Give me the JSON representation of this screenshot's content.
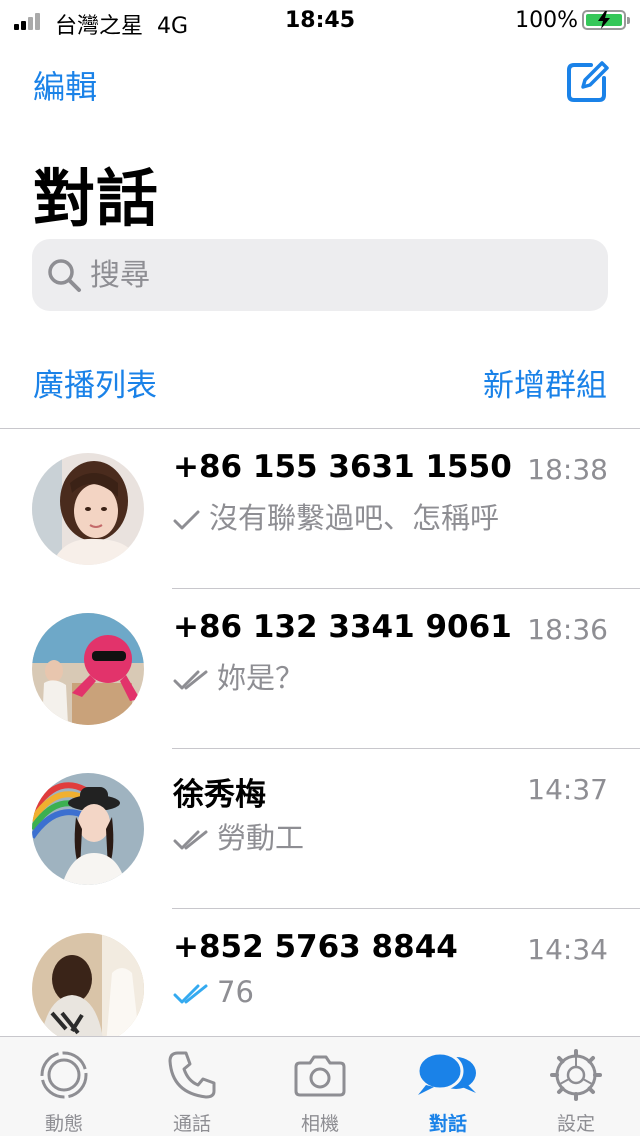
{
  "status_bar": {
    "carrier": "台灣之星",
    "network": "4G",
    "time": "18:45",
    "battery": "100%"
  },
  "nav": {
    "edit_label": "編輯",
    "title": "對話"
  },
  "search": {
    "placeholder": "搜尋"
  },
  "list_actions": {
    "broadcast_label": "廣播列表",
    "new_group_label": "新增群組"
  },
  "chats": [
    {
      "name": "+86 155 3631 1550",
      "time": "18:38",
      "preview": "沒有聯繫過吧、怎稱呼",
      "status": "sent"
    },
    {
      "name": "+86 132 3341 9061",
      "time": "18:36",
      "preview": "妳是？",
      "status": "delivered"
    },
    {
      "name": "徐秀梅",
      "time": "14:37",
      "preview": "勞動工",
      "status": "delivered"
    },
    {
      "name": "+852 5763 8844",
      "time": "14:34",
      "preview": "76",
      "status": "read"
    }
  ],
  "tabs": [
    {
      "label": "動態",
      "icon": "status-icon",
      "active": false
    },
    {
      "label": "通話",
      "icon": "phone-icon",
      "active": false
    },
    {
      "label": "相機",
      "icon": "camera-icon",
      "active": false
    },
    {
      "label": "對話",
      "icon": "chats-icon",
      "active": true
    },
    {
      "label": "設定",
      "icon": "gear-icon",
      "active": false
    }
  ],
  "colors": {
    "accent": "#1a82e8",
    "secondary_text": "#8e8e93",
    "read_check": "#34aaf0",
    "battery_fill": "#35c759"
  }
}
